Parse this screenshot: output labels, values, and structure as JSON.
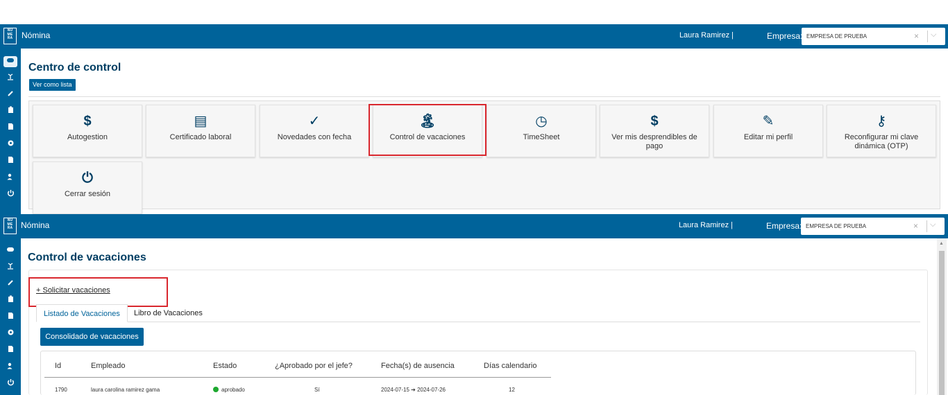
{
  "header": {
    "logo": "NU ME RA",
    "app_name": "Nómina",
    "user": "Laura Ramirez  |",
    "company_label": "Empresa:",
    "company_value": "EMPRESA DE PRUEBA",
    "clear": "×",
    "chevron": "⌵"
  },
  "sidebar_icons": [
    "gamepad-icon",
    "island-icon",
    "brush-icon",
    "clipboard-icon",
    "file-icon",
    "gear-icon",
    "file-dollar-icon",
    "user-edit-icon",
    "power-icon"
  ],
  "control_center": {
    "title": "Centro de control",
    "list_button": "Ver como lista",
    "cards": [
      {
        "label": "Autogestion",
        "icon": "file-dollar-icon",
        "glyph": "$"
      },
      {
        "label": "Certificado laboral",
        "icon": "certificate-icon",
        "glyph": "▤"
      },
      {
        "label": "Novedades con fecha",
        "icon": "calendar-check-icon",
        "glyph": "✓"
      },
      {
        "label": "Control de vacaciones",
        "icon": "island-icon",
        "glyph": "🏝"
      },
      {
        "label": "TimeSheet",
        "icon": "briefcase-clock-icon",
        "glyph": "◷"
      },
      {
        "label": "Ver mis desprendibles de pago",
        "icon": "file-dollar-icon",
        "glyph": "$"
      },
      {
        "label": "Editar mi perfil",
        "icon": "user-edit-icon",
        "glyph": "✎"
      },
      {
        "label": "Reconfigurar mi clave dinámica (OTP)",
        "icon": "key-icon",
        "glyph": "⚷"
      },
      {
        "label": "Cerrar sesión",
        "icon": "power-icon",
        "glyph": "⏻"
      }
    ]
  },
  "vacations": {
    "title": "Control de vacaciones",
    "request_link": "+ Solicitar vacaciones",
    "tabs": [
      "Listado de Vacaciones",
      "Libro de Vacaciones"
    ],
    "consolidated_button": "Consolidado de vacaciones",
    "columns": [
      "Id",
      "Empleado",
      "Estado",
      "¿Aprobado por el jefe?",
      "Fecha(s) de ausencia",
      "Días calendario"
    ],
    "rows": [
      {
        "id": "1790",
        "employee": "laura carolina ramirez gama",
        "status": "aprobado",
        "approved": "Sí",
        "dates": "2024-07-15 ➔ 2024-07-26",
        "days": "12"
      }
    ],
    "status_color": "#1ea830"
  },
  "colors": {
    "brand": "#00639a",
    "title": "#003e63",
    "highlight": "#d9272e"
  }
}
